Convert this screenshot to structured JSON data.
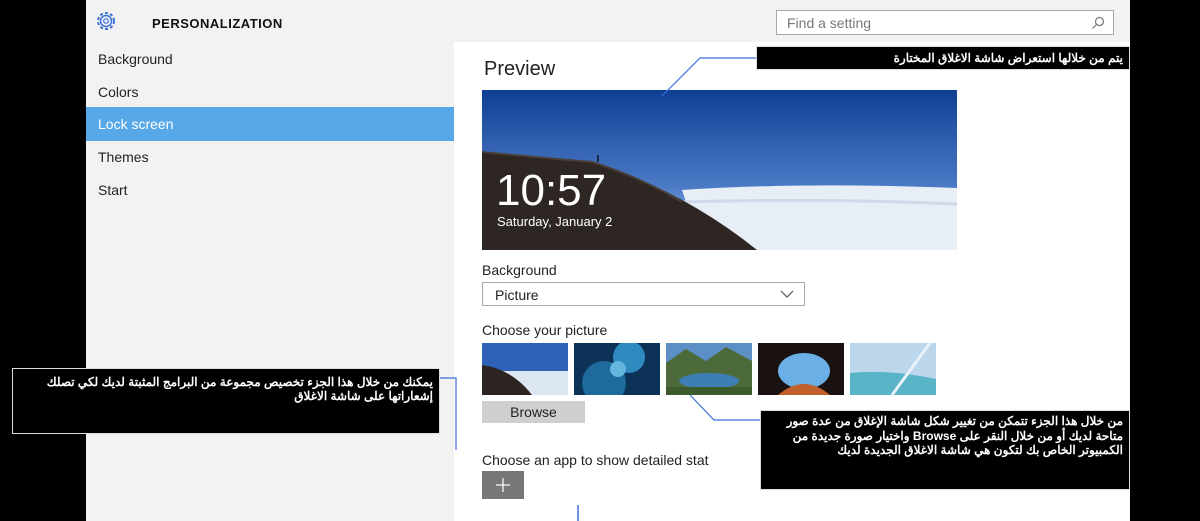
{
  "titlebar": {
    "title": "PERSONALIZATION",
    "search_placeholder": "Find a setting"
  },
  "sidebar": {
    "items": [
      {
        "label": "Background",
        "active": false
      },
      {
        "label": "Colors",
        "active": false
      },
      {
        "label": "Lock screen",
        "active": true
      },
      {
        "label": "Themes",
        "active": false
      },
      {
        "label": "Start",
        "active": false
      }
    ]
  },
  "main": {
    "preview_title": "Preview",
    "preview_time": "10:57",
    "preview_date": "Saturday, January 2",
    "background_label": "Background",
    "background_value": "Picture",
    "choose_picture_label": "Choose your picture",
    "browse_label": "Browse",
    "choose_app_label": "Choose an app to show detailed stat",
    "add_icon": "plus-icon"
  },
  "annotations": {
    "preview_note": "يتم من خلالها استعراض شاشة الاغلاق المختارة",
    "apps_note": "يمكنك من خلال هذا الجزء تخصيص مجموعة من البرامج المثبتة لديك لكي تصلك إشعاراتها على شاشة الاغلاق",
    "picture_note": "من خلال هذا الجزء تتمكن من تغيير شكل شاشة الإغلاق من عدة صور متاحة لديك أو من خلال النقر على Browse واختيار صورة جديدة من الكمبيوتر الخاص بك لتكون هي شاشة الاغلاق الجديدة لديك"
  },
  "colors": {
    "accent": "#58a7e6",
    "callout_bg": "#000000",
    "line": "#3a6fd8"
  }
}
